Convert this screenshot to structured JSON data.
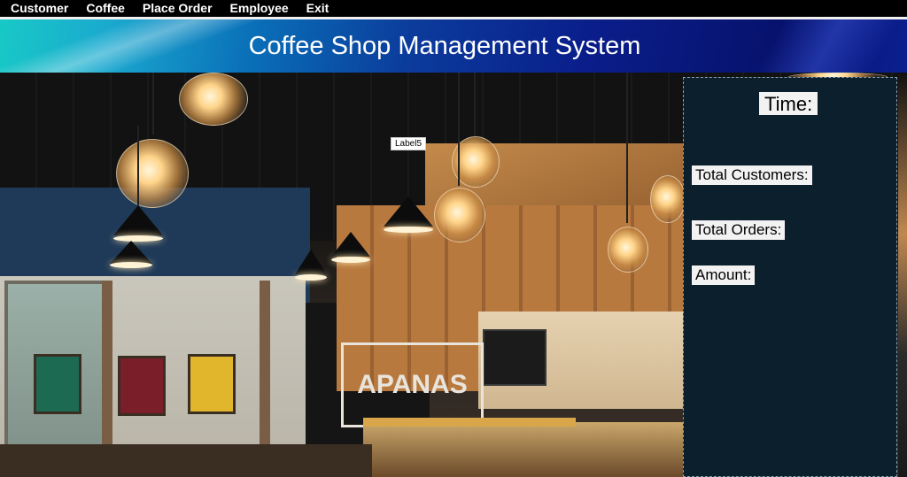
{
  "menu": {
    "items": [
      {
        "label": "Customer"
      },
      {
        "label": "Coffee"
      },
      {
        "label": "Place Order"
      },
      {
        "label": "Employee"
      },
      {
        "label": "Exit"
      }
    ]
  },
  "header": {
    "title": "Coffee Shop Management System"
  },
  "label5": "Label5",
  "panel": {
    "time_label": "Time:",
    "total_customers_label": "Total Customers:",
    "total_orders_label": "Total Orders:",
    "amount_label": "Amount:"
  },
  "background": {
    "sign_text": "APANAS"
  },
  "colors": {
    "menu_bg": "#000000",
    "panel_bg": "#0c1f2c",
    "header_start": "#18c9c6",
    "header_end": "#07126d"
  }
}
